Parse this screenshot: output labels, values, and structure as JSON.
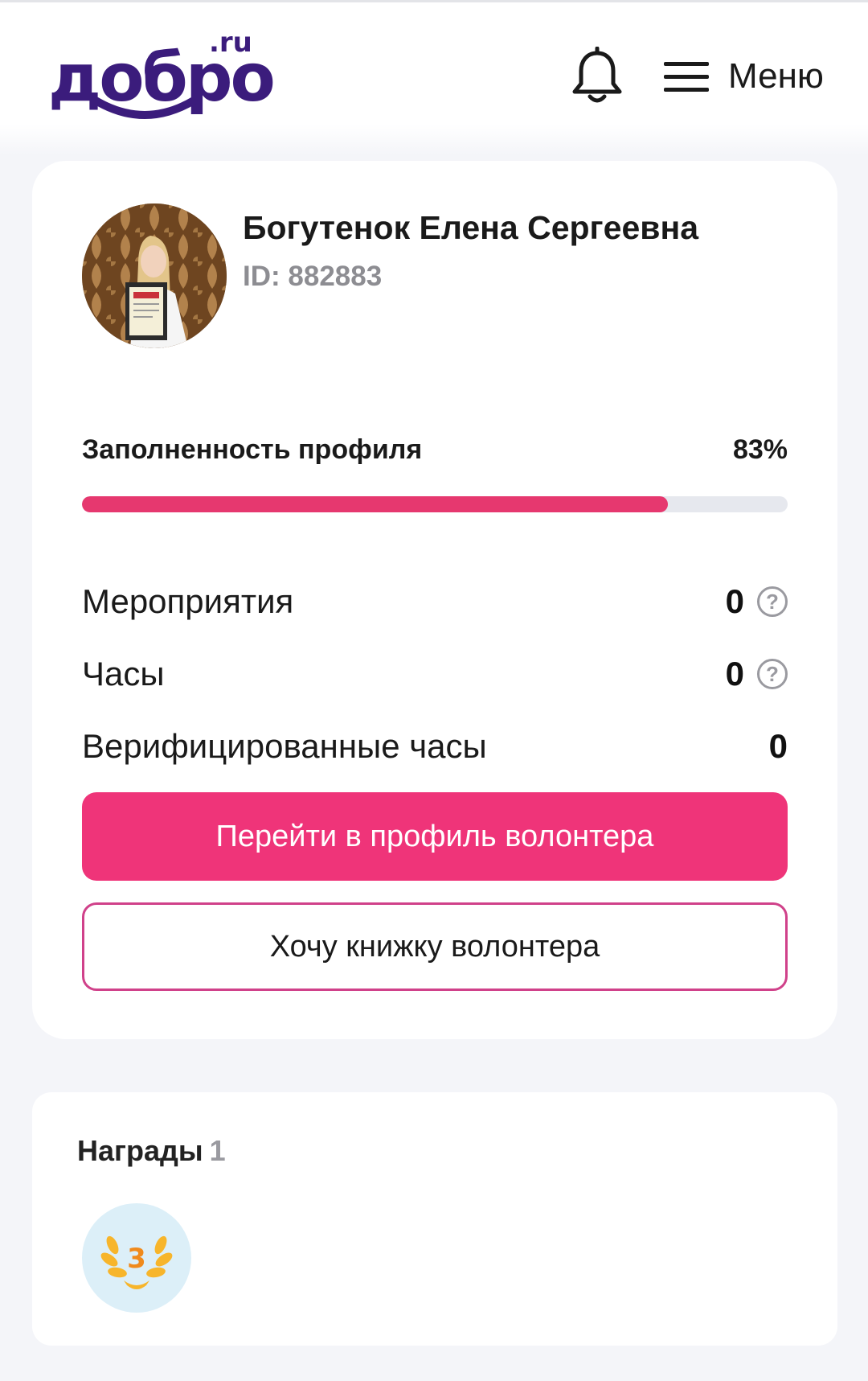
{
  "header": {
    "logo_text": "добро",
    "logo_suffix": ".ru",
    "menu_label": "Меню",
    "icons": [
      "bell-icon",
      "hamburger-icon"
    ]
  },
  "profile": {
    "name": "Богутенок Елена Сергеевна",
    "id_label": "ID:",
    "id_value": "882883",
    "completion_label": "Заполненность профиля",
    "completion_text": "83%",
    "completion_fraction": 0.83,
    "stats": [
      {
        "label": "Мероприятия",
        "value": "0",
        "has_help": true
      },
      {
        "label": "Часы",
        "value": "0",
        "has_help": true
      },
      {
        "label": "Верифицированные часы",
        "value": "0",
        "has_help": false
      }
    ],
    "help_glyph": "?",
    "primary_button": "Перейти в профиль волонтера",
    "secondary_button": "Хочу книжку волонтера"
  },
  "awards": {
    "title": "Награды",
    "count": "1",
    "badge_number": "3"
  },
  "colors": {
    "brand": "#3b1c7c",
    "accent": "#ef3479",
    "progress": "#e6386f",
    "muted": "#8d8d92"
  }
}
